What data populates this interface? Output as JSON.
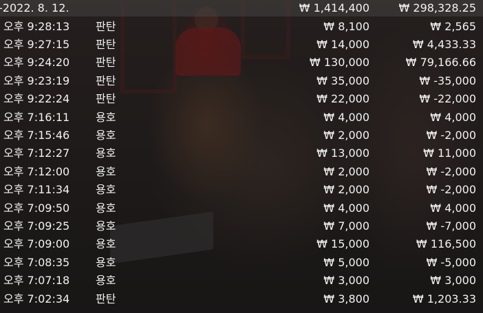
{
  "header": {
    "date": "-2022. 8. 12.",
    "total_bet": "₩ 1,414,400",
    "total_win": "₩ 298,328.25"
  },
  "rows": [
    {
      "time": "오후 9:28:13",
      "game": "판탄",
      "bet": "₩ 8,100",
      "win": "₩ 2,565"
    },
    {
      "time": "오후 9:27:15",
      "game": "판탄",
      "bet": "₩ 14,000",
      "win": "₩ 4,433.33"
    },
    {
      "time": "오후 9:24:20",
      "game": "판탄",
      "bet": "₩ 130,000",
      "win": "₩ 79,166.66"
    },
    {
      "time": "오후 9:23:19",
      "game": "판탄",
      "bet": "₩ 35,000",
      "win": "₩ -35,000"
    },
    {
      "time": "오후 9:22:24",
      "game": "판탄",
      "bet": "₩ 22,000",
      "win": "₩ -22,000"
    },
    {
      "time": "오후 7:16:11",
      "game": "용호",
      "bet": "₩ 4,000",
      "win": "₩ 4,000"
    },
    {
      "time": "오후 7:15:46",
      "game": "용호",
      "bet": "₩ 2,000",
      "win": "₩ -2,000"
    },
    {
      "time": "오후 7:12:27",
      "game": "용호",
      "bet": "₩ 13,000",
      "win": "₩ 11,000"
    },
    {
      "time": "오후 7:12:00",
      "game": "용호",
      "bet": "₩ 2,000",
      "win": "₩ -2,000"
    },
    {
      "time": "오후 7:11:34",
      "game": "용호",
      "bet": "₩ 2,000",
      "win": "₩ -2,000"
    },
    {
      "time": "오후 7:09:50",
      "game": "용호",
      "bet": "₩ 4,000",
      "win": "₩ 4,000"
    },
    {
      "time": "오후 7:09:25",
      "game": "용호",
      "bet": "₩ 7,000",
      "win": "₩ -7,000"
    },
    {
      "time": "오후 7:09:00",
      "game": "용호",
      "bet": "₩ 15,000",
      "win": "₩ 116,500"
    },
    {
      "time": "오후 7:08:35",
      "game": "용호",
      "bet": "₩ 5,000",
      "win": "₩ -5,000"
    },
    {
      "time": "오후 7:07:18",
      "game": "용호",
      "bet": "₩ 3,000",
      "win": "₩ 3,000"
    },
    {
      "time": "오후 7:02:34",
      "game": "판탄",
      "bet": "₩ 3,800",
      "win": "₩ 1,203.33"
    }
  ]
}
